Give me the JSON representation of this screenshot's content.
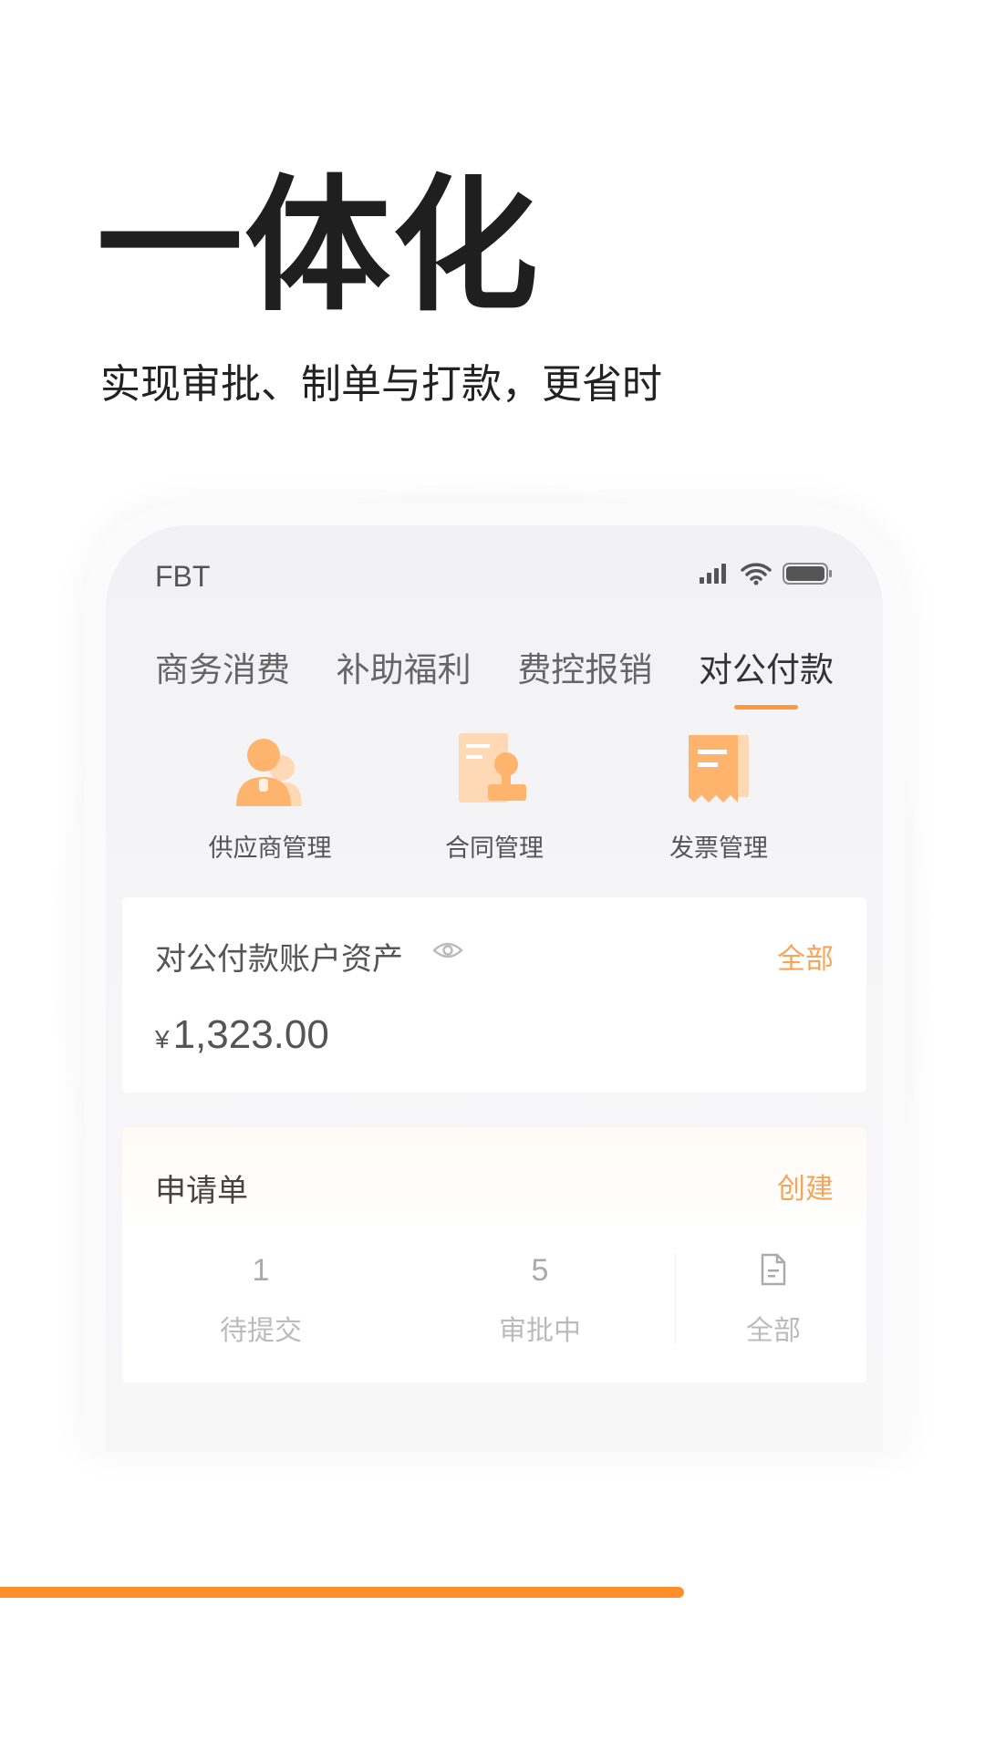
{
  "headline": "一体化",
  "subline": "实现审批、制单与打款，更省时",
  "phone": {
    "status": {
      "carrier": "FBT"
    },
    "tabs": [
      {
        "label": "商务消费",
        "active": false
      },
      {
        "label": "补助福利",
        "active": false
      },
      {
        "label": "费控报销",
        "active": false
      },
      {
        "label": "对公付款",
        "active": true
      }
    ],
    "quick_actions": [
      {
        "label": "供应商管理",
        "icon": "supplier-icon"
      },
      {
        "label": "合同管理",
        "icon": "contract-icon"
      },
      {
        "label": "发票管理",
        "icon": "invoice-icon"
      }
    ],
    "account_card": {
      "title": "对公付款账户资产",
      "link": "全部",
      "currency": "¥",
      "amount": "1,323.00"
    },
    "application_card": {
      "title": "申请单",
      "link": "创建",
      "stats": [
        {
          "value": "1",
          "label": "待提交"
        },
        {
          "value": "5",
          "label": "审批中"
        },
        {
          "value": "",
          "label": "全部",
          "icon": "document-icon"
        }
      ]
    }
  },
  "progress": {
    "fraction": 0.75
  },
  "colors": {
    "accent": "#ff8f2a",
    "accent_light": "#f5a55a",
    "icon_orange": "#ffb46e"
  }
}
